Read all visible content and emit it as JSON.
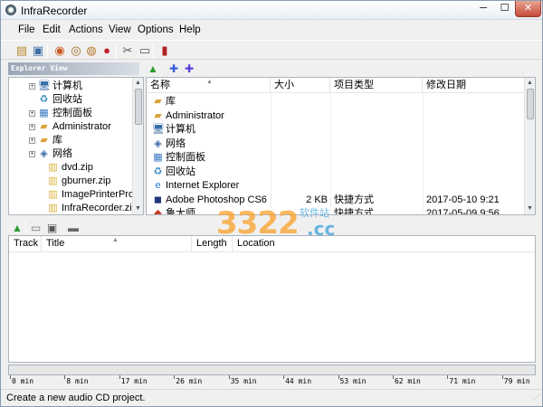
{
  "window": {
    "title": "InfraRecorder"
  },
  "titlebar_buttons": {
    "minimize": "─",
    "maximize": "☐",
    "close": "✕"
  },
  "menu": [
    "File",
    "Edit",
    "Actions",
    "View",
    "Options",
    "Help"
  ],
  "toolbar": {
    "icons": [
      "new-project-icon",
      "open-project-icon",
      "burn-image-icon",
      "copy-disc-icon",
      "erase-disc-icon",
      "record-icon",
      "tools-icon",
      "disc-info-icon",
      "exit-icon"
    ]
  },
  "explorer": {
    "label": "Explorer View",
    "tree": [
      {
        "label": "计算机",
        "icon": "computer-icon",
        "expander": "+"
      },
      {
        "label": "回收站",
        "icon": "recycle-bin-icon",
        "expander": ""
      },
      {
        "label": "控制面板",
        "icon": "control-panel-icon",
        "expander": "+"
      },
      {
        "label": "Administrator",
        "icon": "user-folder-icon",
        "expander": "+"
      },
      {
        "label": "库",
        "icon": "library-icon",
        "expander": "+"
      },
      {
        "label": "网络",
        "icon": "network-icon",
        "expander": "+"
      },
      {
        "label": "dvd.zip",
        "icon": "zip-icon",
        "expander": ""
      },
      {
        "label": "gburner.zip",
        "icon": "zip-icon",
        "expander": ""
      },
      {
        "label": "ImagePrinterPro.zip",
        "icon": "zip-icon",
        "expander": ""
      },
      {
        "label": "InfraRecorder.zip",
        "icon": "zip-icon",
        "expander": ""
      }
    ]
  },
  "browser": {
    "columns": [
      "名称",
      "大小",
      "项目类型",
      "修改日期"
    ],
    "files": [
      {
        "name": "库",
        "size": "",
        "type": "",
        "date": "",
        "icon": "library-icon"
      },
      {
        "name": "Administrator",
        "size": "",
        "type": "",
        "date": "",
        "icon": "user-folder-icon"
      },
      {
        "name": "计算机",
        "size": "",
        "type": "",
        "date": "",
        "icon": "computer-icon"
      },
      {
        "name": "网络",
        "size": "",
        "type": "",
        "date": "",
        "icon": "network-icon"
      },
      {
        "name": "控制面板",
        "size": "",
        "type": "",
        "date": "",
        "icon": "control-panel-icon"
      },
      {
        "name": "回收站",
        "size": "",
        "type": "",
        "date": "",
        "icon": "recycle-bin-icon"
      },
      {
        "name": "Internet Explorer",
        "size": "",
        "type": "",
        "date": "",
        "icon": "ie-icon"
      },
      {
        "name": "Adobe Photoshop CS6",
        "size": "2 KB",
        "type": "快捷方式",
        "date": "2017-05-10 9:21",
        "icon": "photoshop-icon"
      },
      {
        "name": "鲁大师",
        "size": "",
        "type": "快捷方式",
        "date": "2017-05-09 9:56",
        "icon": "app-shortcut-icon"
      }
    ]
  },
  "tracks": {
    "columns": [
      "Track",
      "Title",
      "Length",
      "Location"
    ],
    "rows": []
  },
  "progress": {
    "fill_fraction": 0.0
  },
  "ruler": [
    "0 min",
    "8 min",
    "17 min",
    "26 min",
    "35 min",
    "44 min",
    "53 min",
    "62 min",
    "71 min",
    "79 min"
  ],
  "status": {
    "text": "Create a new audio CD project."
  },
  "watermark": {
    "number": "3322",
    "suffix": ".cc",
    "cn": "软件站"
  }
}
